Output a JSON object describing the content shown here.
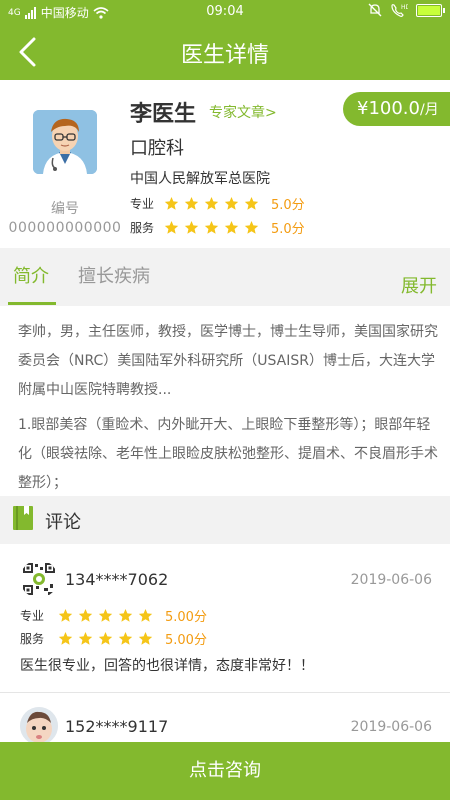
{
  "status_bar": {
    "carrier": "中国移动",
    "signal": "4G",
    "time": "09:04",
    "network": "HD"
  },
  "nav": {
    "title": "医生详情",
    "back_icon": "chevron-left-icon"
  },
  "doctor": {
    "name": "李医生",
    "expert_articles_link": "专家文章>",
    "price": "¥100.0",
    "price_unit": "/月",
    "department": "口腔科",
    "hospital": "中国人民解放军总医院",
    "id_label": "编号",
    "id_value": "000000000000",
    "ratings": [
      {
        "label": "专业",
        "stars": 5,
        "score": "5.0分"
      },
      {
        "label": "服务",
        "stars": 5,
        "score": "5.0分"
      }
    ]
  },
  "tabs": {
    "items": [
      {
        "label": "简介",
        "active": true
      },
      {
        "label": "擅长疾病",
        "active": false
      }
    ],
    "expand_label": "展开"
  },
  "intro": {
    "paragraph_1": "李帅，男，主任医师，教授，医学博士，博士生导师，美国国家研究委员会（NRC）美国陆军外科研究所（USAISR）博士后，大连大学附属中山医院特聘教授...",
    "paragraph_2": "1.眼部美容（重睑术、内外眦开大、上眼睑下垂整形等）；眼部年轻化（眼袋祛除、老年性上眼睑皮肤松弛整形、提眉术、不良眉形手术整形）；"
  },
  "comments_section": {
    "title": "评论",
    "icon": "book-icon",
    "items": [
      {
        "user": "134****7062",
        "date": "2019-06-06",
        "ratings": [
          {
            "label": "专业",
            "stars": 5,
            "score": "5.00分"
          },
          {
            "label": "服务",
            "stars": 5,
            "score": "5.00分"
          }
        ],
        "text": "医生很专业，回答的也很详情，态度非常好！！"
      },
      {
        "user": "152****9117",
        "date": "2019-06-06"
      }
    ]
  },
  "consult_button": {
    "label": "点击咨询"
  },
  "colors": {
    "brand_green": "#83b92e",
    "star_yellow": "#f5c518",
    "score_orange": "#f39c12"
  }
}
